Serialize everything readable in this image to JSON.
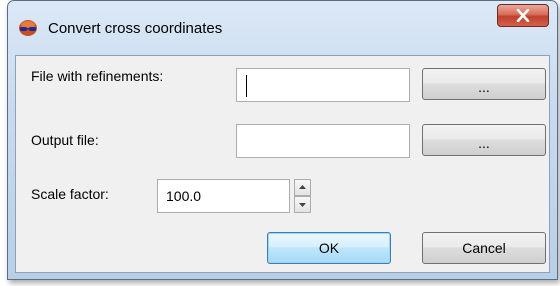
{
  "window": {
    "title": "Convert cross coordinates",
    "close_icon": "close-icon"
  },
  "form": {
    "refinements_label": "File with refinements:",
    "refinements_value": "",
    "refinements_browse": "...",
    "output_label": "Output file:",
    "output_value": "",
    "output_browse": "...",
    "scale_label": "Scale factor:",
    "scale_value": "100.0"
  },
  "buttons": {
    "ok": "OK",
    "cancel": "Cancel"
  },
  "colors": {
    "title_gradient_top": "#dbe8f6",
    "close_button": "#c0412c",
    "default_button_border": "#3c7fb1",
    "client_background": "#f0f0f0"
  }
}
